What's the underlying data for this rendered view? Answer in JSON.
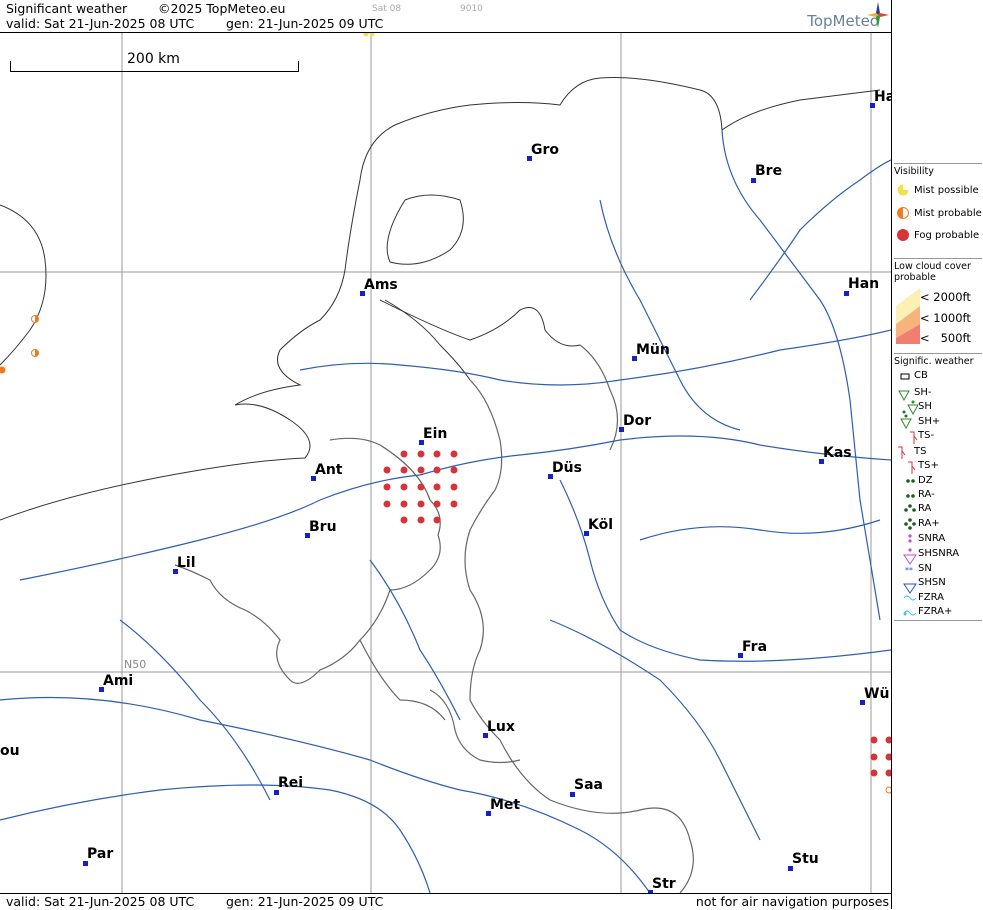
{
  "header": {
    "title": "Significant weather",
    "copyright": "©2025 TopMeteo.eu",
    "day_code": "Sat 08",
    "code_num": "9010",
    "valid": "valid:  Sat  21-Jun-2025  08 UTC",
    "gen": "gen:  21-Jun-2025 09 UTC",
    "brand": "TopMeteo"
  },
  "footer": {
    "valid": "valid:  Sat  21-Jun-2025  08 UTC",
    "gen": "gen:  21-Jun-2025 09 UTC",
    "note": "not for air navigation purposes"
  },
  "map": {
    "scale_label": "200 km",
    "lat_label": "N50",
    "cities": [
      {
        "name": "Ha"
      },
      {
        "name": "Gro"
      },
      {
        "name": "Bre"
      },
      {
        "name": "Ams"
      },
      {
        "name": "Han"
      },
      {
        "name": "Mün"
      },
      {
        "name": "Ein"
      },
      {
        "name": "Dor"
      },
      {
        "name": "Ant"
      },
      {
        "name": "Düs"
      },
      {
        "name": "Kas"
      },
      {
        "name": "Bru"
      },
      {
        "name": "Köl"
      },
      {
        "name": "Lil"
      },
      {
        "name": "Fra"
      },
      {
        "name": "Ami"
      },
      {
        "name": "Wü"
      },
      {
        "name": "Lux"
      },
      {
        "name": "ou"
      },
      {
        "name": "Rei"
      },
      {
        "name": "Saa"
      },
      {
        "name": "Met"
      },
      {
        "name": "Stu"
      },
      {
        "name": "Par"
      },
      {
        "name": "Str"
      }
    ]
  },
  "legend": {
    "visibility_title": "Visibility",
    "visibility": [
      "Mist possible",
      "Mist probable",
      "Fog probable"
    ],
    "cloud_title": "Low cloud cover probable",
    "cloud": [
      "< 2000ft",
      "< 1000ft",
      "<   500ft"
    ],
    "sigwx_title": "Signific. weather",
    "sigwx": [
      "CB",
      "SH-",
      "SH",
      "SH+",
      "TS-",
      "TS",
      "TS+",
      "DZ",
      "RA-",
      "RA",
      "RA+",
      "SNRA",
      "SHSNRA",
      "SN",
      "SHSN",
      "FZRA",
      "FZRA+"
    ],
    "colors": {
      "mist_possible": "#f2e04a",
      "mist_probable": "#f07a1e",
      "fog": "#d8323a",
      "river": "#2d5fb0",
      "border": "#555555",
      "coast": "#333333",
      "city_dot": "#1222c8"
    }
  }
}
